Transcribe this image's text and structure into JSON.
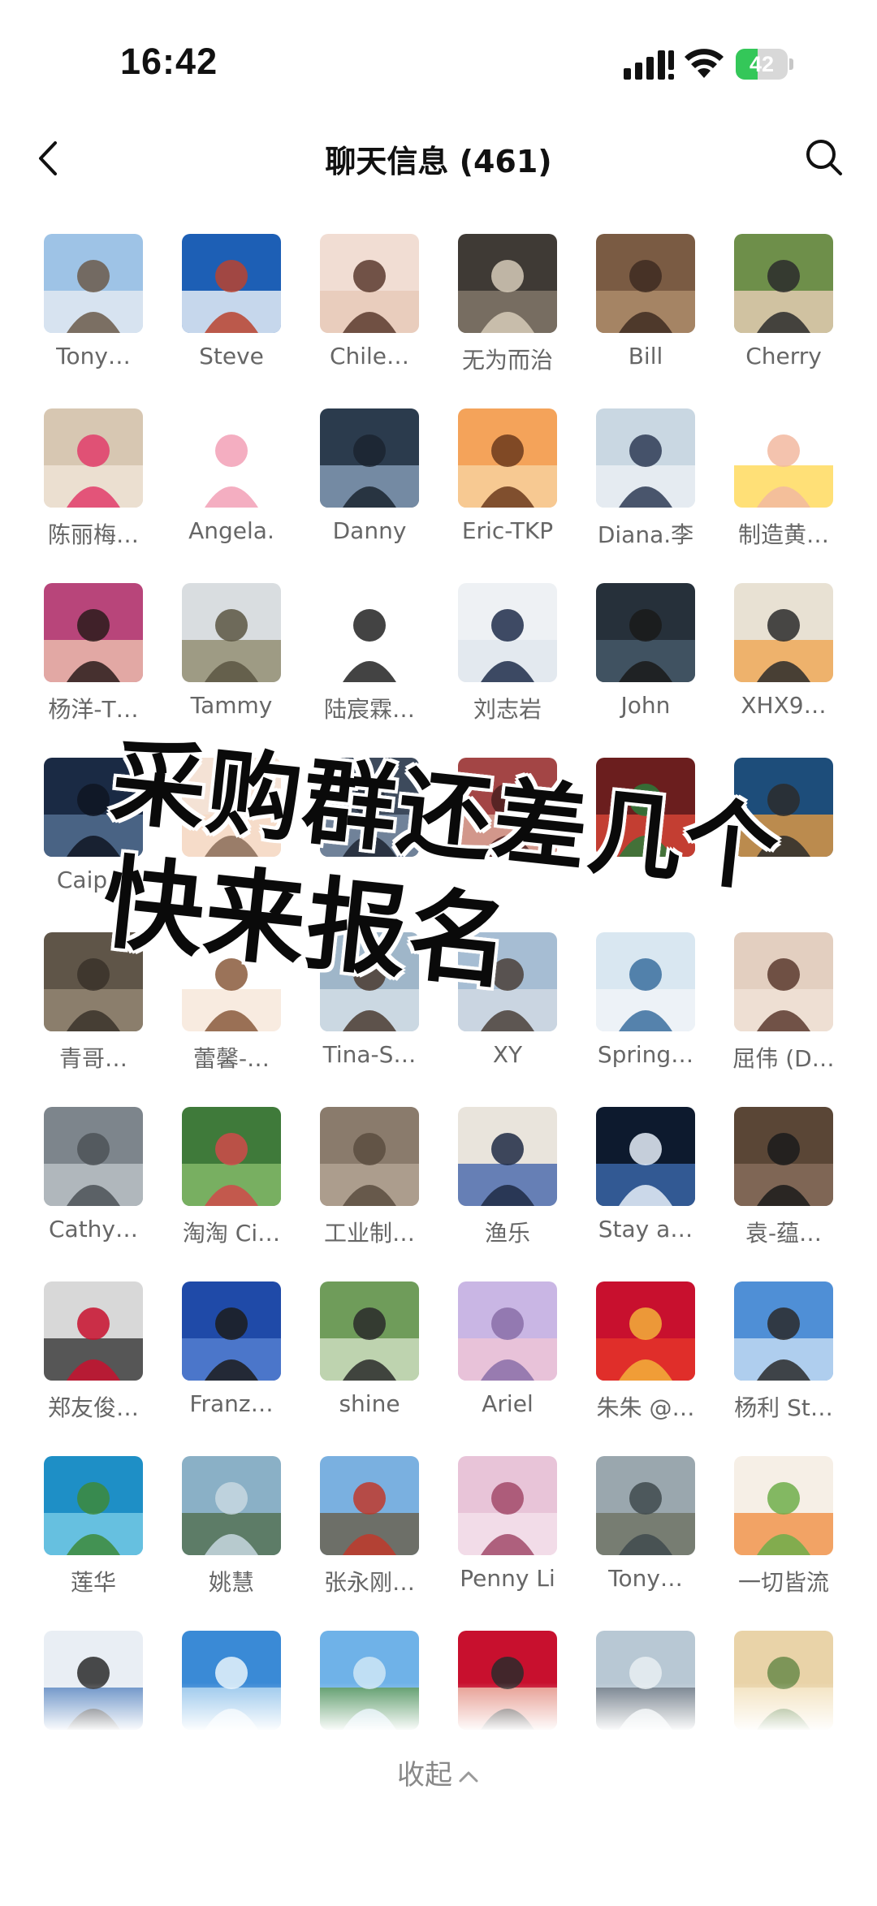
{
  "status_bar": {
    "time": "16:42",
    "battery_level": "42",
    "battery_fraction": 0.42,
    "battery_color": "#34c759",
    "signal_icon": "cellular-signal-icon",
    "wifi_icon": "wifi-icon"
  },
  "nav": {
    "title": "聊天信息 (461)",
    "back_icon": "chevron-left-icon",
    "search_icon": "search-icon"
  },
  "members": [
    {
      "name": "Tony…",
      "colors": [
        "#9ec3e6",
        "#e9eef3",
        "#6b5a4a"
      ]
    },
    {
      "name": "Steve",
      "colors": [
        "#1d5fb5",
        "#ffffff",
        "#b9432f"
      ]
    },
    {
      "name": "Chile…",
      "colors": [
        "#f1ddd3",
        "#e6c7b6",
        "#5a3a2e"
      ]
    },
    {
      "name": "无为而治",
      "colors": [
        "#3f3a35",
        "#8b7f70",
        "#d6cbb8"
      ]
    },
    {
      "name": "Bill",
      "colors": [
        "#7a5b43",
        "#b4926f",
        "#3e2c21"
      ]
    },
    {
      "name": "Cherry",
      "colors": [
        "#6e8f4a",
        "#f2d3bf",
        "#2b2b2b"
      ]
    },
    {
      "name": "陈丽梅…",
      "colors": [
        "#d7c7b2",
        "#f1e7da",
        "#e23c6a"
      ]
    },
    {
      "name": "Angela.",
      "colors": [
        "#ffffff",
        "#ffffff",
        "#f2a0b6"
      ]
    },
    {
      "name": "Danny",
      "colors": [
        "#2b3b4d",
        "#8da6c0",
        "#1b2430"
      ]
    },
    {
      "name": "Eric-TKP",
      "colors": [
        "#f4a35a",
        "#f8d6a6",
        "#6b3a1c"
      ]
    },
    {
      "name": "Diana.李",
      "colors": [
        "#c9d7e2",
        "#eef2f5",
        "#2e3b55"
      ]
    },
    {
      "name": "制造黄…",
      "colors": [
        "#ffffff",
        "#ffd54a",
        "#f2b8a0"
      ]
    },
    {
      "name": "杨洋-T…",
      "colors": [
        "#b8457a",
        "#f0c9b3",
        "#2a1b1b"
      ]
    },
    {
      "name": "Tammy",
      "colors": [
        "#d9dde0",
        "#8a8466",
        "#5b5642"
      ]
    },
    {
      "name": "陆宸霖…",
      "colors": [
        "#ffffff",
        "#ffffff",
        "#222222"
      ]
    },
    {
      "name": "刘志岩",
      "colors": [
        "#eef1f4",
        "#dfe6ee",
        "#1e2d4a"
      ]
    },
    {
      "name": "John",
      "colors": [
        "#26303a",
        "#4a5d6f",
        "#1a1a1a"
      ]
    },
    {
      "name": "XHX9…",
      "colors": [
        "#e8e1d3",
        "#f0a24a",
        "#2a2a2a"
      ]
    },
    {
      "name": "Caip…",
      "colors": [
        "#1a2a44",
        "#5a7799",
        "#0f1522"
      ]
    },
    {
      "name": "",
      "colors": [
        "#f4e2d5",
        "#f7d9c4",
        "#8a6c58"
      ]
    },
    {
      "name": "",
      "colors": [
        "#3d4a5c",
        "#8296ad",
        "#1d2633"
      ]
    },
    {
      "name": "",
      "colors": [
        "#a34545",
        "#e2b3a3",
        "#4b1f1f"
      ]
    },
    {
      "name": "",
      "colors": [
        "#6b1e1e",
        "#e04a3a",
        "#2d7a3a"
      ]
    },
    {
      "name": "",
      "colors": [
        "#1d4d7a",
        "#f0a040",
        "#2b2b2b"
      ]
    },
    {
      "name": "青哥…",
      "colors": [
        "#5f5548",
        "#9a8c78",
        "#3a322a"
      ]
    },
    {
      "name": "蕾馨-…",
      "colors": [
        "#ffffff",
        "#f6e4d6",
        "#8a5a3c"
      ]
    },
    {
      "name": "Tina-S…",
      "colors": [
        "#9fb6c9",
        "#d9e3ea",
        "#4a3b30"
      ]
    },
    {
      "name": "XY",
      "colors": [
        "#a6bdd3",
        "#d5dde5",
        "#4a4038"
      ]
    },
    {
      "name": "Spring…",
      "colors": [
        "#d9e7f1",
        "#f3f6f8",
        "#3a6f9f"
      ]
    },
    {
      "name": "屈伟 (D…",
      "colors": [
        "#e3cfc0",
        "#f1e4da",
        "#5b3a2e"
      ]
    },
    {
      "name": "Cathy…",
      "colors": [
        "#7d858c",
        "#c2c8cc",
        "#4c5257"
      ]
    },
    {
      "name": "淘淘 Ci…",
      "colors": [
        "#3f7a3a",
        "#8cc26f",
        "#d04a4a"
      ]
    },
    {
      "name": "工业制…",
      "colors": [
        "#8a7b6c",
        "#b7a898",
        "#5a4d40"
      ]
    },
    {
      "name": "渔乐",
      "colors": [
        "#e9e4dc",
        "#3a5ea8",
        "#1f2a44"
      ]
    },
    {
      "name": "Stay a…",
      "colors": [
        "#0d1a2e",
        "#3f6fb5",
        "#e6eef8"
      ]
    },
    {
      "name": "袁-蕴…",
      "colors": [
        "#5a4636",
        "#8c7260",
        "#1b1b1b"
      ]
    },
    {
      "name": "郑友俊…",
      "colors": [
        "#d8d8d8",
        "#2b2b2b",
        "#c8102e"
      ]
    },
    {
      "name": "Franz…",
      "colors": [
        "#1f4aa8",
        "#5b86d6",
        "#1c1c1c"
      ]
    },
    {
      "name": "shine",
      "colors": [
        "#6f9c5a",
        "#d8e6cc",
        "#2a2a2a"
      ]
    },
    {
      "name": "Ariel",
      "colors": [
        "#c9b6e4",
        "#f1c6d6",
        "#8a6fa8"
      ]
    },
    {
      "name": "朱朱 @…",
      "colors": [
        "#c8102e",
        "#e8382a",
        "#f2b03a"
      ]
    },
    {
      "name": "杨利 St…",
      "colors": [
        "#4f8fd6",
        "#cfe3f6",
        "#2a2a2a"
      ]
    },
    {
      "name": "莲华",
      "colors": [
        "#1e8fc6",
        "#7fd0e8",
        "#3d8a3a"
      ]
    },
    {
      "name": "姚慧",
      "colors": [
        "#8ab0c6",
        "#4e6b47",
        "#c7d8e0"
      ]
    },
    {
      "name": "张永刚…",
      "colors": [
        "#7ab0e0",
        "#6a5a40",
        "#c0392b"
      ]
    },
    {
      "name": "Penny Li",
      "colors": [
        "#e8c4d8",
        "#f6e4ee",
        "#a24a6a"
      ]
    },
    {
      "name": "Tony…",
      "colors": [
        "#9aa7ae",
        "#6b6f5e",
        "#3f4a4e"
      ]
    },
    {
      "name": "一切皆流",
      "colors": [
        "#f6efe6",
        "#f08a3a",
        "#6fae4a"
      ]
    },
    {
      "name": "",
      "colors": [
        "#e9eef4",
        "#3a6fb5",
        "#2a2a2a"
      ]
    },
    {
      "name": "",
      "colors": [
        "#3a8ad6",
        "#b9dbf3",
        "#e8f3fb"
      ]
    },
    {
      "name": "",
      "colors": [
        "#6fb2e8",
        "#4f8f3a",
        "#cfe6f6"
      ]
    },
    {
      "name": "",
      "colors": [
        "#c8102e",
        "#f0c8b0",
        "#2a2a2a"
      ]
    },
    {
      "name": "",
      "colors": [
        "#b8c8d4",
        "#5a6470",
        "#e8eef2"
      ]
    },
    {
      "name": "",
      "colors": [
        "#e9d3a8",
        "#f6e8c8",
        "#6a8a4a"
      ]
    }
  ],
  "overlay": {
    "line1": "采购群还差几个",
    "line2": "快来报名"
  },
  "footer": {
    "collapse_label": "收起",
    "collapse_icon": "chevron-up-icon"
  }
}
